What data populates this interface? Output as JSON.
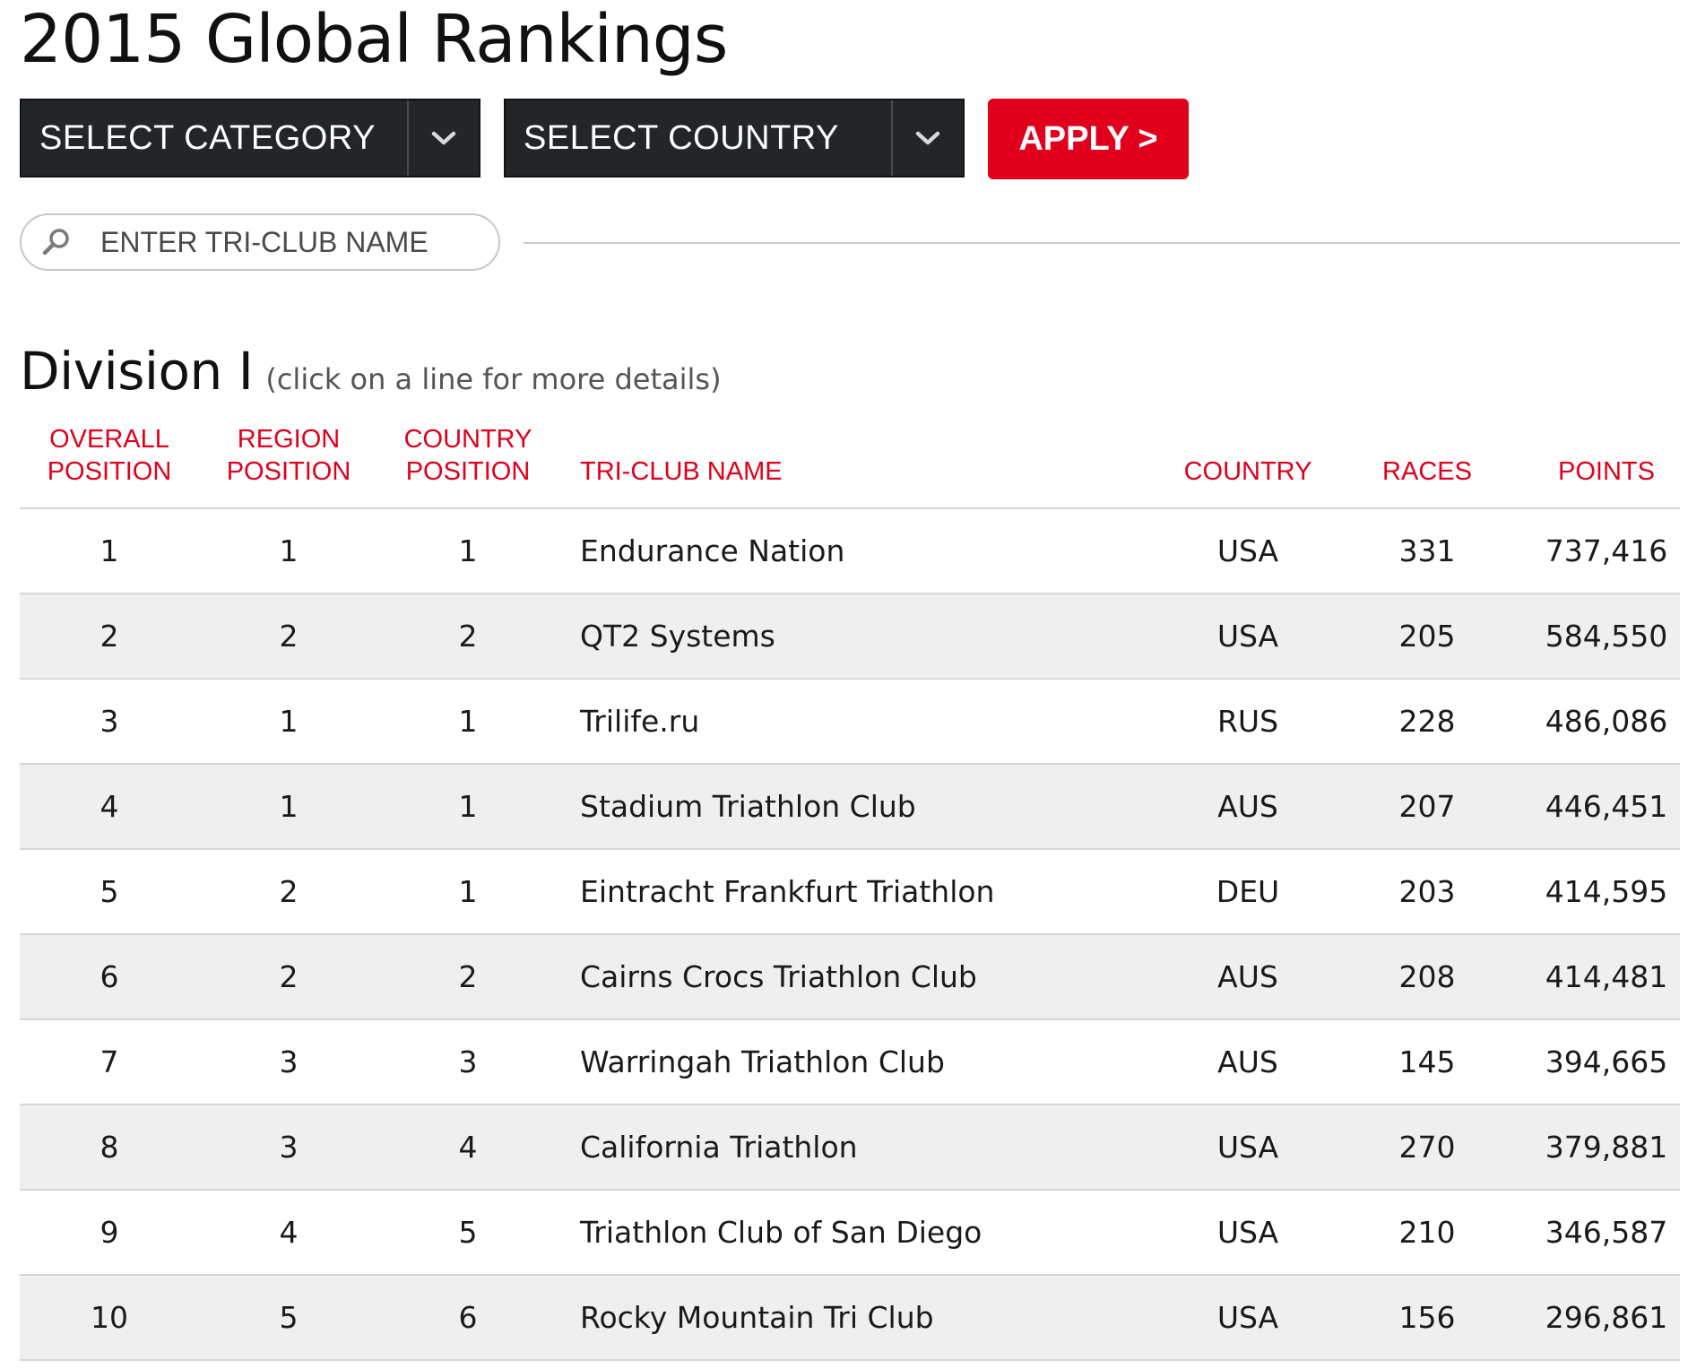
{
  "page": {
    "title": "2015 Global Rankings"
  },
  "filters": {
    "category_label": "SELECT CATEGORY",
    "country_label": "SELECT COUNTRY",
    "apply_label": "APPLY >"
  },
  "search": {
    "placeholder": "ENTER TRI-CLUB NAME"
  },
  "division": {
    "title": "Division I",
    "hint": "(click on a line for more details)"
  },
  "table": {
    "headers": {
      "overall_line1": "OVERALL",
      "overall_line2": "POSITION",
      "region_line1": "REGION",
      "region_line2": "POSITION",
      "country_pos_line1": "COUNTRY",
      "country_pos_line2": "POSITION",
      "name": "TRI-CLUB NAME",
      "country": "COUNTRY",
      "races": "RACES",
      "points": "POINTS"
    },
    "rows": [
      {
        "overall": "1",
        "region": "1",
        "country_pos": "1",
        "name": "Endurance Nation",
        "country": "USA",
        "races": "331",
        "points": "737,416"
      },
      {
        "overall": "2",
        "region": "2",
        "country_pos": "2",
        "name": "QT2 Systems",
        "country": "USA",
        "races": "205",
        "points": "584,550"
      },
      {
        "overall": "3",
        "region": "1",
        "country_pos": "1",
        "name": "Trilife.ru",
        "country": "RUS",
        "races": "228",
        "points": "486,086"
      },
      {
        "overall": "4",
        "region": "1",
        "country_pos": "1",
        "name": "Stadium Triathlon Club",
        "country": "AUS",
        "races": "207",
        "points": "446,451"
      },
      {
        "overall": "5",
        "region": "2",
        "country_pos": "1",
        "name": "Eintracht Frankfurt Triathlon",
        "country": "DEU",
        "races": "203",
        "points": "414,595"
      },
      {
        "overall": "6",
        "region": "2",
        "country_pos": "2",
        "name": "Cairns Crocs Triathlon Club",
        "country": "AUS",
        "races": "208",
        "points": "414,481"
      },
      {
        "overall": "7",
        "region": "3",
        "country_pos": "3",
        "name": "Warringah Triathlon Club",
        "country": "AUS",
        "races": "145",
        "points": "394,665"
      },
      {
        "overall": "8",
        "region": "3",
        "country_pos": "4",
        "name": "California Triathlon",
        "country": "USA",
        "races": "270",
        "points": "379,881"
      },
      {
        "overall": "9",
        "region": "4",
        "country_pos": "5",
        "name": "Triathlon Club of San Diego",
        "country": "USA",
        "races": "210",
        "points": "346,587"
      },
      {
        "overall": "10",
        "region": "5",
        "country_pos": "6",
        "name": "Rocky Mountain Tri Club",
        "country": "USA",
        "races": "156",
        "points": "296,861"
      }
    ]
  },
  "colors": {
    "accent": "#e0001b",
    "select_bg": "#232628",
    "alt_row_bg": "#efefef",
    "divider": "#d6d6d6"
  },
  "icons": {
    "select_arrow": "chevron-down-icon",
    "search": "search-icon"
  }
}
